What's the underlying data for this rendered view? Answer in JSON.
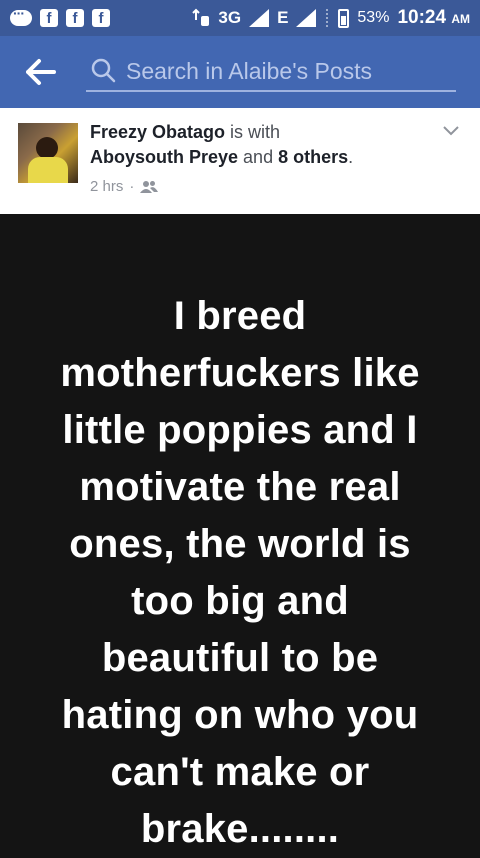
{
  "status_bar": {
    "network": "3G",
    "network2": "E",
    "battery": "53%",
    "time": "10:24",
    "ampm": "AM"
  },
  "search": {
    "placeholder": "Search in Alaibe's Posts"
  },
  "post": {
    "author": "Freezy Obatago",
    "is_with": " is with ",
    "tagged": "Aboysouth Preye",
    "and": " and ",
    "others": "8 others",
    "period": ".",
    "time": "2 hrs",
    "separator": "·",
    "audience_icon": "friends-icon"
  },
  "content": {
    "text": "I breed\nmotherfuckers like\nlittle poppies and I\nmotivate the real\nones, the world is\ntoo big and\nbeautiful to be\nhating on who you\ncan't make or\nbrake........"
  },
  "colors": {
    "status_bar": "#3b5998",
    "app_bar": "#4267b2",
    "content_bg": "#141414"
  }
}
